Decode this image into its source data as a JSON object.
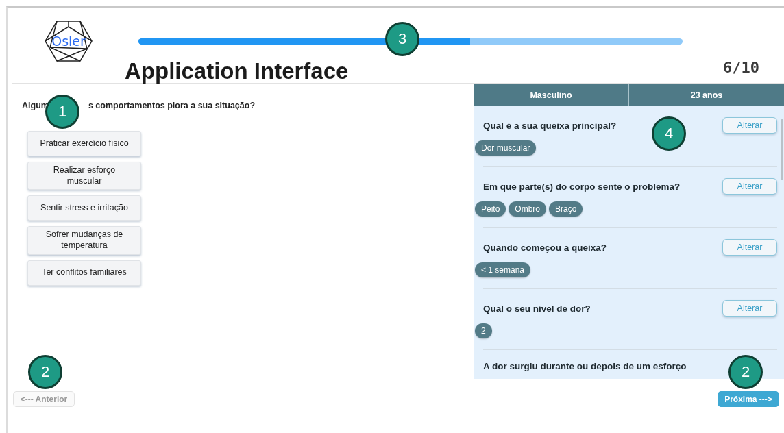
{
  "logo": {
    "text": "Osler"
  },
  "progress": {
    "level": 0.61
  },
  "title": "Application Interface",
  "step": "6/10",
  "question": [
    "Algum",
    "s comportamentos piora a sua situação?"
  ],
  "options": [
    {
      "label": "Praticar exercício físico"
    },
    {
      "label": "Realizar esforço muscular"
    },
    {
      "label": "Sentir stress e irritação"
    },
    {
      "label": "Sofrer mudanças de temperatura"
    },
    {
      "label": "Ter conflitos familiares"
    }
  ],
  "summary": {
    "header": [
      "Masculino",
      "23 anos"
    ],
    "items": [
      {
        "question": "Qual é a sua queixa principal?",
        "action": "Alterar",
        "answers": [
          "Dor muscular"
        ]
      },
      {
        "question": "Em que parte(s) do corpo sente o problema?",
        "action": "Alterar",
        "answers": [
          "Peito",
          "Ombro",
          "Braço"
        ]
      },
      {
        "question": "Quando começou a queixa?",
        "action": "Alterar",
        "answers": [
          "< 1 semana"
        ]
      },
      {
        "question": "Qual o seu nível de dor?",
        "action": "Alterar",
        "answers": [
          "2"
        ]
      },
      {
        "question": "A dor surgiu durante ou depois de um esforço"
      }
    ]
  },
  "nav": {
    "back": {
      "label": "<--- Anterior",
      "disabled": true
    },
    "next": {
      "label": "Próxima --->",
      "disabled": false
    }
  },
  "markers": [
    {
      "label": "1"
    },
    {
      "label": "3"
    },
    {
      "label": "4"
    },
    {
      "label": "2"
    },
    {
      "label": "2"
    }
  ]
}
